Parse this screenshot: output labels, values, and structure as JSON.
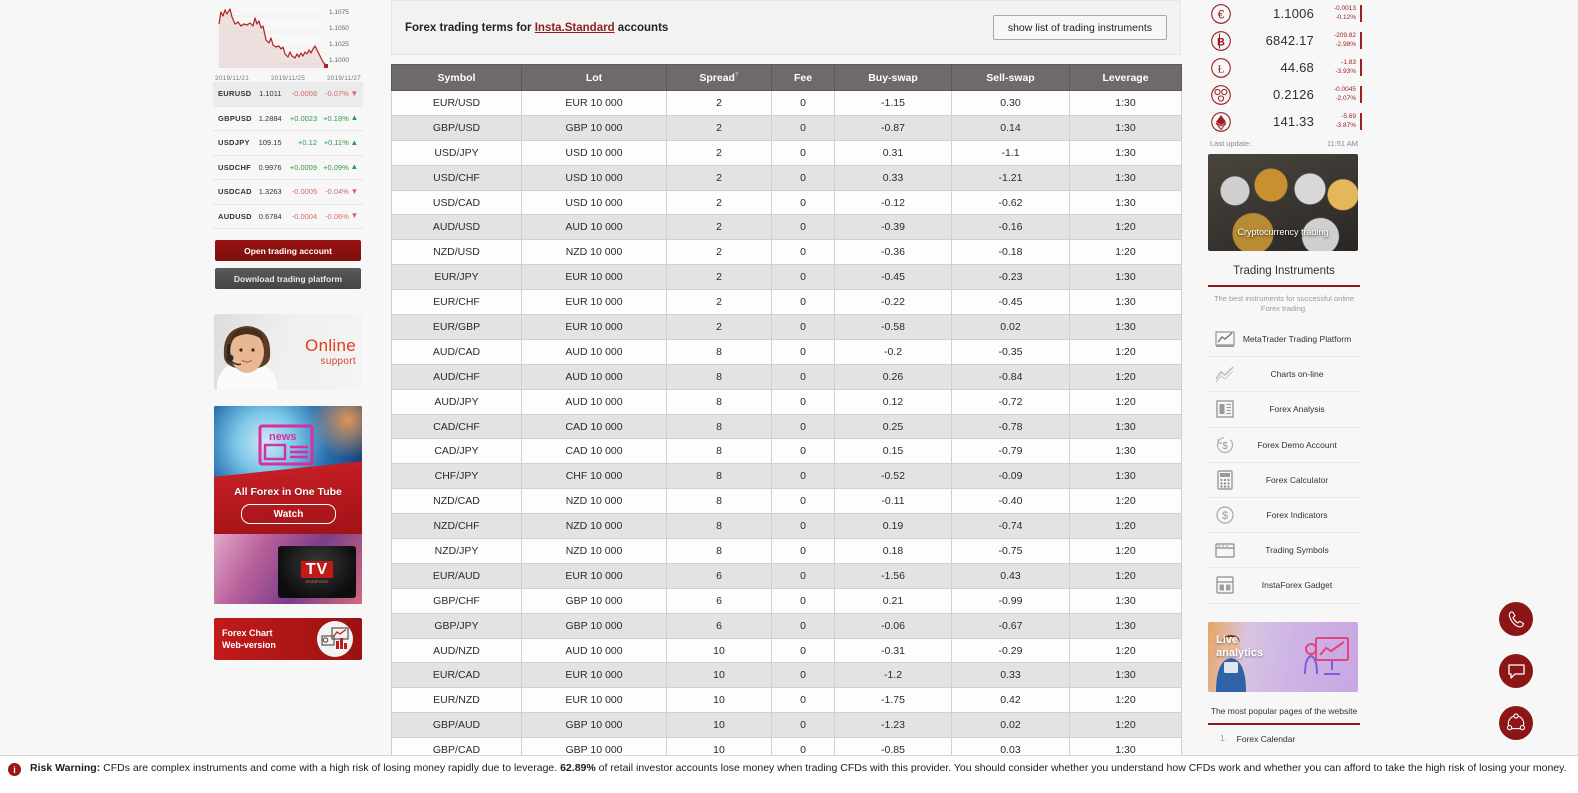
{
  "quotes_chart": {
    "y_ticks": [
      "1.1075",
      "1.1050",
      "1.1025",
      "1.1000"
    ],
    "x_ticks": [
      "2019/11/21",
      "2019/11/25",
      "2019/11/27"
    ]
  },
  "quotes": [
    {
      "symbol": "EURUSD",
      "price": "1.1011",
      "change": "-0.0008",
      "percent": "-0.07%",
      "dir": "down",
      "selected": true
    },
    {
      "symbol": "GBPUSD",
      "price": "1.2884",
      "change": "+0.0023",
      "percent": "+0.18%",
      "dir": "up",
      "selected": false
    },
    {
      "symbol": "USDJPY",
      "price": "109.15",
      "change": "+0.12",
      "percent": "+0.11%",
      "dir": "up",
      "selected": false
    },
    {
      "symbol": "USDCHF",
      "price": "0.9976",
      "change": "+0.0009",
      "percent": "+0.09%",
      "dir": "up",
      "selected": false
    },
    {
      "symbol": "USDCAD",
      "price": "1.3263",
      "change": "-0.0005",
      "percent": "-0.04%",
      "dir": "down",
      "selected": false
    },
    {
      "symbol": "AUDUSD",
      "price": "0.6784",
      "change": "-0.0004",
      "percent": "-0.06%",
      "dir": "down",
      "selected": false
    }
  ],
  "left_buttons": {
    "open_account": "Open trading account",
    "download_platform": "Download trading platform"
  },
  "support_banner": {
    "line1": "Online",
    "line2": "support"
  },
  "tube_banner": {
    "title": "All Forex in One Tube",
    "button": "Watch",
    "tv_label": "TV",
    "tv_sub": "InstaForex"
  },
  "chart_web_banner": {
    "line1": "Forex Chart",
    "line2": "Web-version"
  },
  "main": {
    "terms_prefix": "Forex trading terms for ",
    "terms_link": "Insta.Standard",
    "terms_suffix": " accounts",
    "instruments_button": "show list of trading instruments",
    "columns": [
      "Symbol",
      "Lot",
      "Spread",
      "Fee",
      "Buy-swap",
      "Sell-swap",
      "Leverage"
    ],
    "spread_sup": "?",
    "rows": [
      [
        "EUR/USD",
        "EUR 10 000",
        "2",
        "0",
        "-1.15",
        "0.30",
        "1:30"
      ],
      [
        "GBP/USD",
        "GBP 10 000",
        "2",
        "0",
        "-0.87",
        "0.14",
        "1:30"
      ],
      [
        "USD/JPY",
        "USD 10 000",
        "2",
        "0",
        "0.31",
        "-1.1",
        "1:30"
      ],
      [
        "USD/CHF",
        "USD 10 000",
        "2",
        "0",
        "0.33",
        "-1.21",
        "1:30"
      ],
      [
        "USD/CAD",
        "USD 10 000",
        "2",
        "0",
        "-0.12",
        "-0.62",
        "1:30"
      ],
      [
        "AUD/USD",
        "AUD 10 000",
        "2",
        "0",
        "-0.39",
        "-0.16",
        "1:20"
      ],
      [
        "NZD/USD",
        "NZD 10 000",
        "2",
        "0",
        "-0.36",
        "-0.18",
        "1:20"
      ],
      [
        "EUR/JPY",
        "EUR 10 000",
        "2",
        "0",
        "-0.45",
        "-0.23",
        "1:30"
      ],
      [
        "EUR/CHF",
        "EUR 10 000",
        "2",
        "0",
        "-0.22",
        "-0.45",
        "1:30"
      ],
      [
        "EUR/GBP",
        "EUR 10 000",
        "2",
        "0",
        "-0.58",
        "0.02",
        "1:30"
      ],
      [
        "AUD/CAD",
        "AUD 10 000",
        "8",
        "0",
        "-0.2",
        "-0.35",
        "1:20"
      ],
      [
        "AUD/CHF",
        "AUD 10 000",
        "8",
        "0",
        "0.26",
        "-0.84",
        "1:20"
      ],
      [
        "AUD/JPY",
        "AUD 10 000",
        "8",
        "0",
        "0.12",
        "-0.72",
        "1:20"
      ],
      [
        "CAD/CHF",
        "CAD 10 000",
        "8",
        "0",
        "0.25",
        "-0.78",
        "1:30"
      ],
      [
        "CAD/JPY",
        "CAD 10 000",
        "8",
        "0",
        "0.15",
        "-0.79",
        "1:30"
      ],
      [
        "CHF/JPY",
        "CHF 10 000",
        "8",
        "0",
        "-0.52",
        "-0.09",
        "1:30"
      ],
      [
        "NZD/CAD",
        "NZD 10 000",
        "8",
        "0",
        "-0.11",
        "-0.40",
        "1:20"
      ],
      [
        "NZD/CHF",
        "NZD 10 000",
        "8",
        "0",
        "0.19",
        "-0.74",
        "1:20"
      ],
      [
        "NZD/JPY",
        "NZD 10 000",
        "8",
        "0",
        "0.18",
        "-0.75",
        "1:20"
      ],
      [
        "EUR/AUD",
        "EUR 10 000",
        "6",
        "0",
        "-1.56",
        "0.43",
        "1:20"
      ],
      [
        "GBP/CHF",
        "GBP 10 000",
        "6",
        "0",
        "0.21",
        "-0.99",
        "1:30"
      ],
      [
        "GBP/JPY",
        "GBP 10 000",
        "6",
        "0",
        "-0.06",
        "-0.67",
        "1:30"
      ],
      [
        "AUD/NZD",
        "AUD 10 000",
        "10",
        "0",
        "-0.31",
        "-0.29",
        "1:20"
      ],
      [
        "EUR/CAD",
        "EUR 10 000",
        "10",
        "0",
        "-1.2",
        "0.33",
        "1:30"
      ],
      [
        "EUR/NZD",
        "EUR 10 000",
        "10",
        "0",
        "-1.75",
        "0.42",
        "1:20"
      ],
      [
        "GBP/AUD",
        "GBP 10 000",
        "10",
        "0",
        "-1.23",
        "0.02",
        "1:20"
      ],
      [
        "GBP/CAD",
        "GBP 10 000",
        "10",
        "0",
        "-0.85",
        "0.03",
        "1:30"
      ]
    ]
  },
  "crypto": {
    "rows": [
      {
        "icon": "euro-icon",
        "price": "1.1006",
        "abs": "-0.0013",
        "pct": "-0.12%"
      },
      {
        "icon": "bitcoin-icon",
        "price": "6842.17",
        "abs": "-209.82",
        "pct": "-2.98%"
      },
      {
        "icon": "litecoin-icon",
        "price": "44.68",
        "abs": "-1.83",
        "pct": "-3.93%"
      },
      {
        "icon": "ripple-icon",
        "price": "0.2126",
        "abs": "-0.0045",
        "pct": "-2.07%"
      },
      {
        "icon": "ethereum-icon",
        "price": "141.33",
        "abs": "-5.69",
        "pct": "-3.87%"
      }
    ],
    "last_update_label": "Last update:",
    "last_update_time": "11:51 AM",
    "banner_caption": "Cryptocurrency trading"
  },
  "instruments_panel": {
    "title": "Trading Instruments",
    "subtitle": "The best instruments for successful online Forex trading.",
    "items": [
      {
        "label": "MetaTrader Trading Platform",
        "icon": "chart-platform-icon"
      },
      {
        "label": "Charts on-line",
        "icon": "line-chart-icon"
      },
      {
        "label": "Forex Analysis",
        "icon": "newspaper-icon"
      },
      {
        "label": "Forex Demo Account",
        "icon": "dollar-refresh-icon"
      },
      {
        "label": "Forex Calculator",
        "icon": "calculator-icon"
      },
      {
        "label": "Forex Indicators",
        "icon": "dollar-circle-icon"
      },
      {
        "label": "Trading Symbols",
        "icon": "window-icon"
      },
      {
        "label": "InstaForex Gadget",
        "icon": "gadget-icon"
      }
    ]
  },
  "live_banner": {
    "line1": "Live",
    "line2": "analytics"
  },
  "popular": {
    "title": "The most popular pages of the website",
    "items": [
      {
        "num": "1.",
        "label": "Forex Calendar"
      }
    ]
  },
  "fabs": [
    {
      "name": "phone-fab",
      "icon": "phone-icon"
    },
    {
      "name": "chat-fab",
      "icon": "chat-icon"
    },
    {
      "name": "share-fab",
      "icon": "share-icon"
    }
  ],
  "risk": {
    "label": "Risk Warning:",
    "text": " CFDs are complex instruments and come with a high risk of losing money rapidly due to leverage. ",
    "percent": "62.89%",
    "text2": " of retail investor accounts lose money when trading CFDs with this provider. You should consider whether you understand how CFDs work and whether you can afford to take the high risk of losing your money."
  }
}
